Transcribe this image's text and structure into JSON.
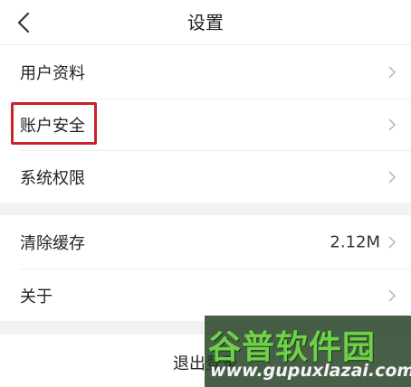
{
  "header": {
    "title": "设置"
  },
  "sections": [
    {
      "items": [
        {
          "label": "用户资料"
        },
        {
          "label": "账户安全"
        },
        {
          "label": "系统权限"
        }
      ]
    },
    {
      "items": [
        {
          "label": "清除缓存",
          "value": "2.12M"
        },
        {
          "label": "关于"
        }
      ]
    }
  ],
  "logout": {
    "label": "退出登录"
  },
  "watermark": {
    "brand": "谷普软件园",
    "url": "www.gupuxlazai.com"
  },
  "colors": {
    "highlight": "#c8222a",
    "section_gap": "#f2f2f2",
    "watermark_green": "#6fd14a"
  }
}
